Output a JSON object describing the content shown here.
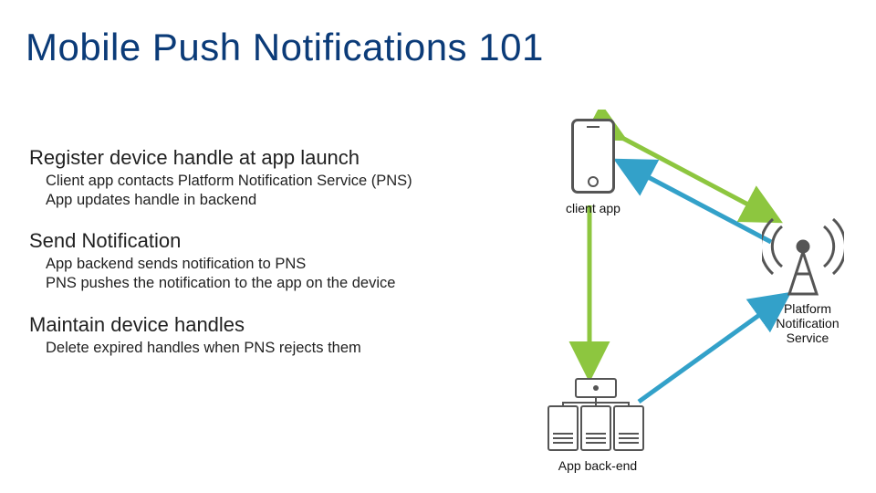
{
  "title": "Mobile Push Notifications 101",
  "sections": [
    {
      "heading": "Register device handle at app launch",
      "bullets": [
        "Client app contacts Platform Notification Service (PNS)",
        "App updates handle in backend"
      ]
    },
    {
      "heading": "Send Notification",
      "bullets": [
        "App backend sends notification to PNS",
        "PNS pushes the notification to the app on the device"
      ]
    },
    {
      "heading": "Maintain device handles",
      "bullets": [
        "Delete expired handles when PNS rejects them"
      ]
    }
  ],
  "diagram": {
    "client_label": "client app",
    "backend_label": "App back-end",
    "pns_label_l1": "Platform",
    "pns_label_l2": "Notification",
    "pns_label_l3": "Service"
  },
  "colors": {
    "title": "#0b3b78",
    "arrow_green": "#8dc63f",
    "arrow_blue": "#33a1c9",
    "icon_stroke": "#555555"
  }
}
